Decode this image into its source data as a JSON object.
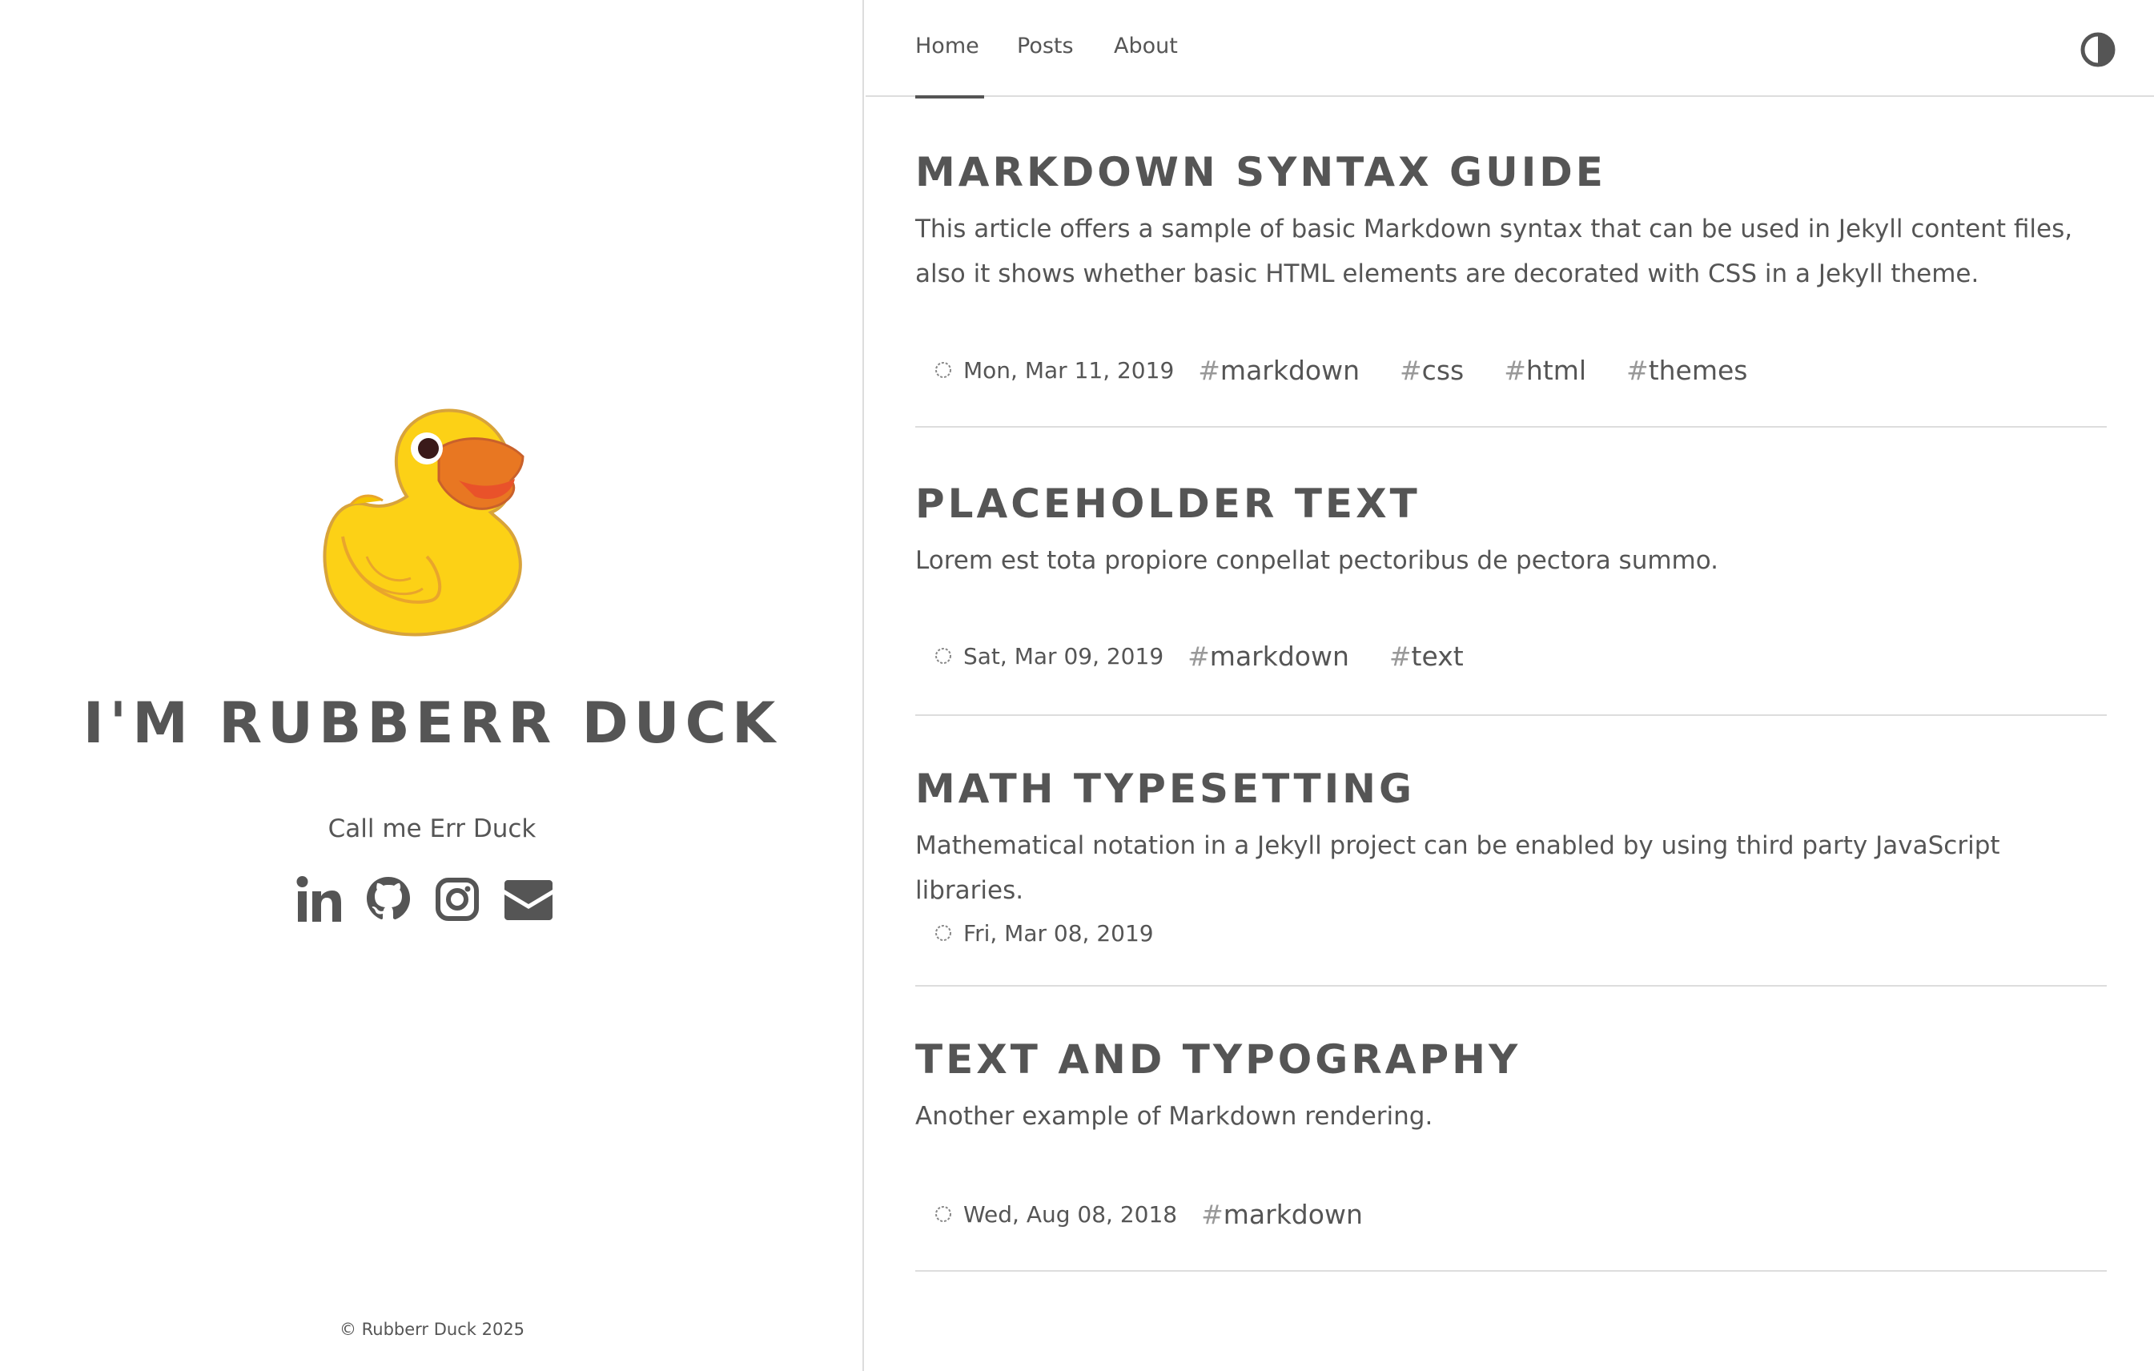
{
  "sidebar": {
    "title": "I'M RUBBERR DUCK",
    "tagline": "Call me Err Duck",
    "social": [
      {
        "icon": "linkedin-icon"
      },
      {
        "icon": "github-icon"
      },
      {
        "icon": "instagram-icon"
      },
      {
        "icon": "email-icon"
      }
    ],
    "copyright": "© Rubberr Duck 2025"
  },
  "nav": {
    "items": [
      {
        "label": "Home",
        "active": true
      },
      {
        "label": "Posts"
      },
      {
        "label": "About"
      }
    ],
    "theme_toggle_icon": "contrast-icon"
  },
  "posts": [
    {
      "title": "MARKDOWN SYNTAX GUIDE",
      "excerpt": "This article offers a sample of basic Markdown syntax that can be used in Jekyll content files, also it shows whether basic HTML elements are decorated with CSS in a Jekyll theme.",
      "date": "Mon, Mar 11, 2019",
      "tags": [
        "markdown",
        "css",
        "html",
        "themes"
      ]
    },
    {
      "title": "PLACEHOLDER TEXT",
      "excerpt": "Lorem est tota propiore conpellat pectoribus de pectora summo.",
      "date": "Sat, Mar 09, 2019",
      "tags": [
        "markdown",
        "text"
      ]
    },
    {
      "title": "MATH TYPESETTING",
      "excerpt": "Mathematical notation in a Jekyll project can be enabled by using third party JavaScript libraries.",
      "date": "Fri, Mar 08, 2019",
      "tags": []
    },
    {
      "title": "TEXT AND TYPOGRAPHY",
      "excerpt": "Another example of Markdown rendering.",
      "date": "Wed, Aug 08, 2018",
      "tags": [
        "markdown"
      ]
    }
  ],
  "colors": {
    "text": "#555555",
    "divider": "#dddddd",
    "duck_body": "#fcd116",
    "duck_beak": "#e87722"
  }
}
